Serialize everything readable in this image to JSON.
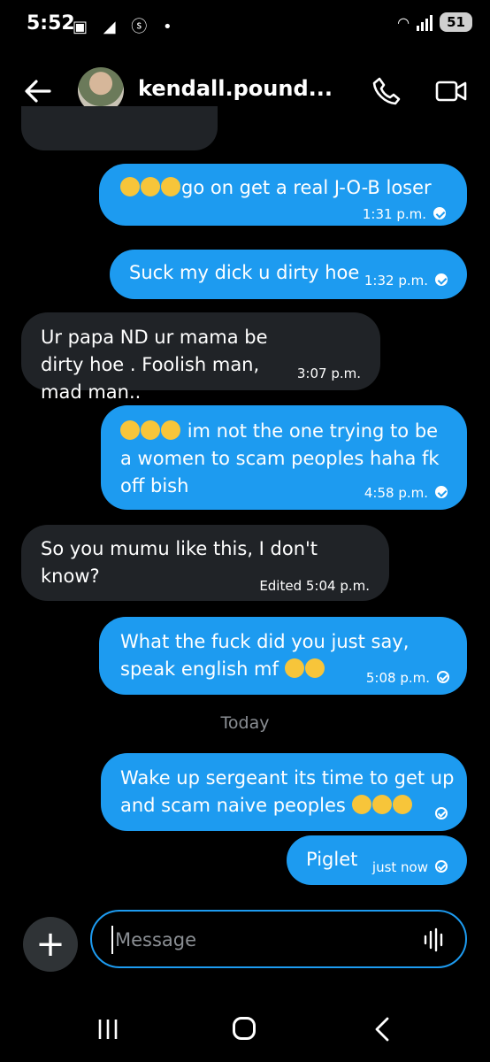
{
  "status_bar": {
    "time": "5:52",
    "battery": "51"
  },
  "header": {
    "contact_name": "kendall.pound..."
  },
  "messages": [
    {
      "direction": "sent",
      "text": "go on get a real J-O-B  loser",
      "time": "1:31 p.m.",
      "read": true
    },
    {
      "direction": "sent",
      "text": "Suck my dick u dirty hoe",
      "time": "1:32 p.m.",
      "read": true
    },
    {
      "direction": "received",
      "text": "Ur papa ND ur mama be dirty hoe . Foolish man, mad man..",
      "time": "3:07 p.m."
    },
    {
      "direction": "sent",
      "text": "im  not the one trying to be a women to scam peoples haha  fk off bish",
      "time": "4:58 p.m.",
      "read": true
    },
    {
      "direction": "received",
      "text": "So you mumu  like this,  I don't know?",
      "time": "Edited 5:04 p.m."
    },
    {
      "direction": "sent",
      "text": "What the fuck did you just say, speak english mf",
      "time": "5:08 p.m.",
      "read": false
    },
    {
      "direction": "sent",
      "text": "Wake up sergeant its time to get up and scam naive peoples",
      "time": "",
      "read": false
    },
    {
      "direction": "sent",
      "text": "Piglet",
      "time": "just now",
      "read": false
    }
  ],
  "divider": "Today",
  "compose": {
    "placeholder": "Message"
  },
  "colors": {
    "sent_bubble": "#1d9bf0",
    "received_bubble": "#202327",
    "background": "#000000"
  },
  "icons": [
    "back-arrow-icon",
    "phone-icon",
    "video-camera-icon",
    "plus-icon",
    "voice-wave-icon",
    "recents-icon",
    "home-icon",
    "nav-back-icon"
  ]
}
